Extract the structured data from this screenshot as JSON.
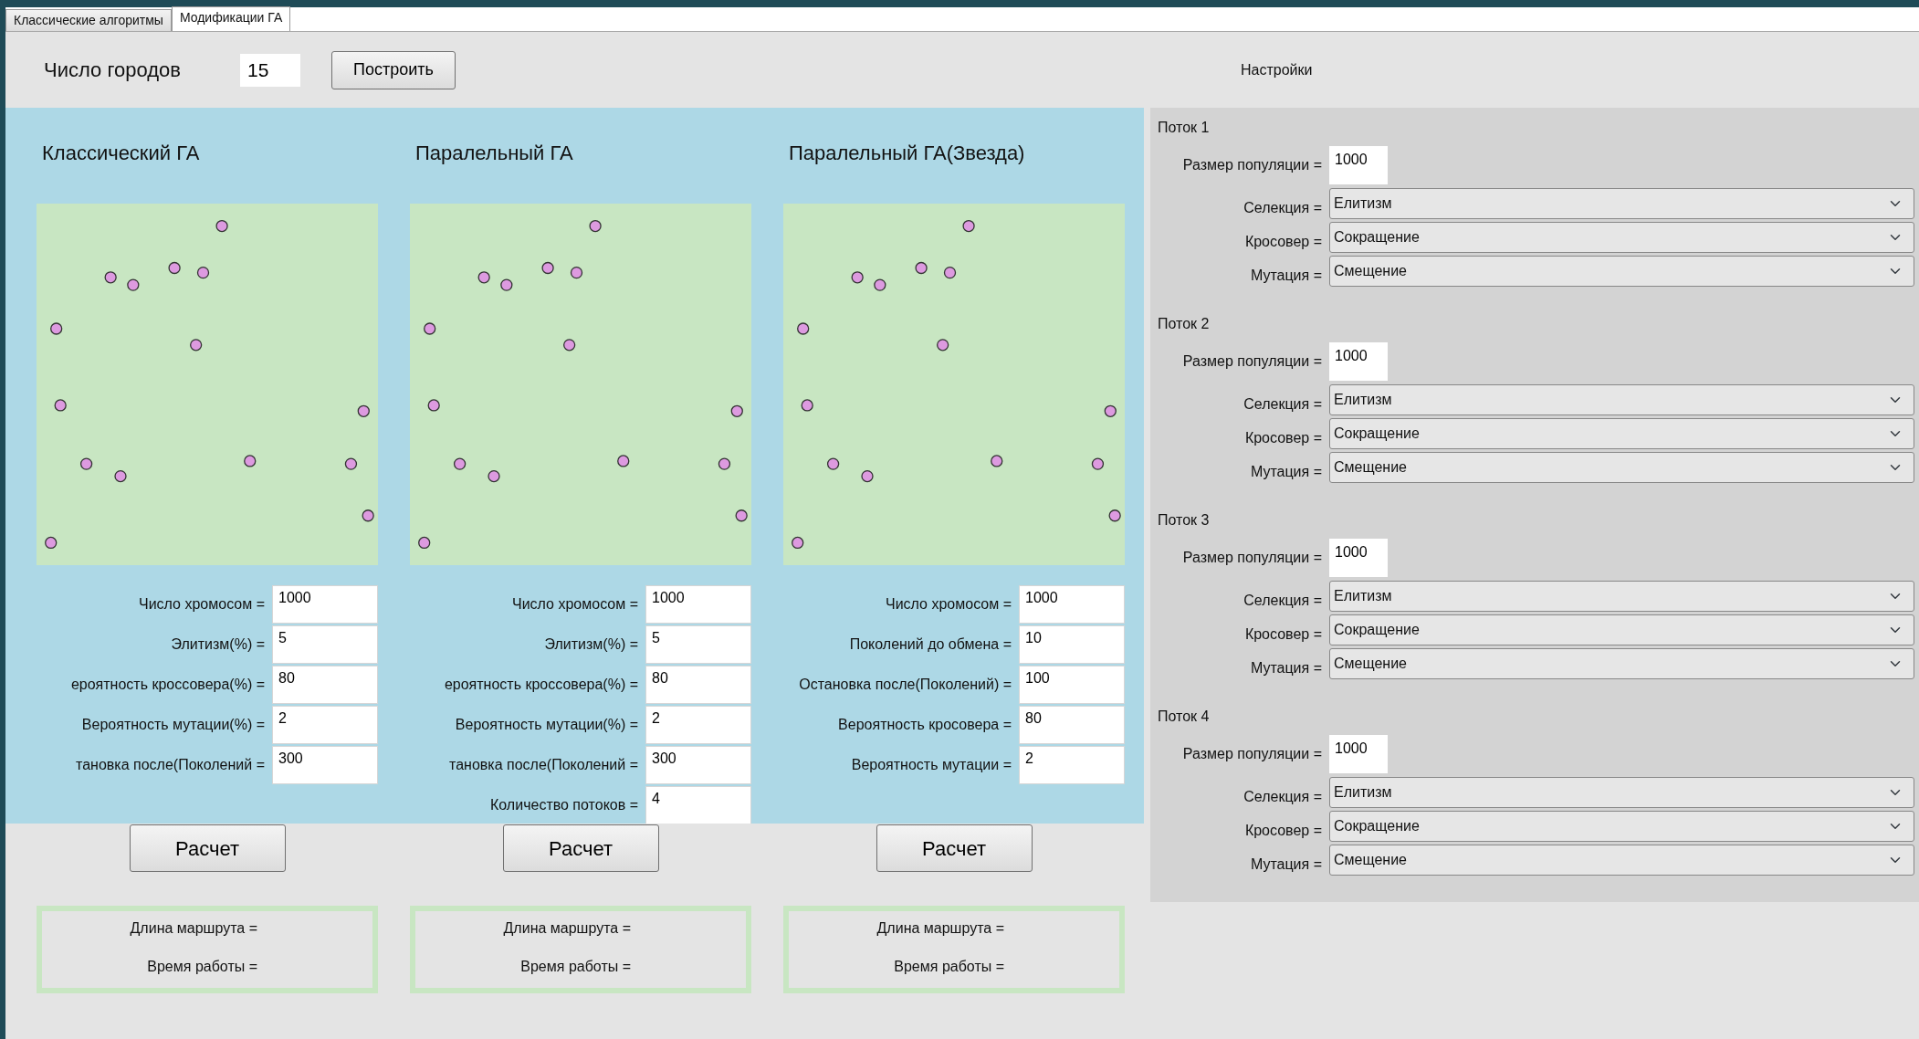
{
  "tabs": [
    {
      "label": "Классические алгоритмы",
      "selected": false
    },
    {
      "label": "Модификации ГА",
      "selected": true
    }
  ],
  "header": {
    "cities_label": "Число городов",
    "cities_value": "15",
    "build_button": "Построить",
    "settings_label": "Настройки"
  },
  "algorithms": [
    {
      "title": "Классический ГА",
      "fields": [
        {
          "label": "Число хромосом =",
          "value": "1000"
        },
        {
          "label": "Элитизм(%) =",
          "value": "5"
        },
        {
          "label": "ероятность кроссовера(%) =",
          "value": "80"
        },
        {
          "label": "Вероятность мутации(%) =",
          "value": "2"
        },
        {
          "label": "тановка после(Поколений =",
          "value": "300"
        }
      ],
      "button": "Расчет",
      "results": [
        "Длина маршрута =",
        "Время работы ="
      ]
    },
    {
      "title": "Паралельный ГА",
      "fields": [
        {
          "label": "Число хромосом =",
          "value": "1000"
        },
        {
          "label": "Элитизм(%) =",
          "value": "5"
        },
        {
          "label": "ероятность кроссовера(%) =",
          "value": "80"
        },
        {
          "label": "Вероятность мутации(%) =",
          "value": "2"
        },
        {
          "label": "тановка после(Поколений =",
          "value": "300"
        },
        {
          "label": "Количество потоков =",
          "value": "4"
        }
      ],
      "button": "Расчет",
      "results": [
        "Длина маршрута =",
        "Время работы ="
      ]
    },
    {
      "title": "Паралельный ГА(Звезда)",
      "fields": [
        {
          "label": "Число хромосом =",
          "value": "1000"
        },
        {
          "label": "Поколений до обмена =",
          "value": "10"
        },
        {
          "label": "Остановка после(Поколений) =",
          "value": "100"
        },
        {
          "label": "Вероятность кросовера =",
          "value": "80"
        },
        {
          "label": "Вероятность мутации =",
          "value": "2"
        }
      ],
      "button": "Расчет",
      "results": [
        "Длина маршрута =",
        "Время работы ="
      ]
    }
  ],
  "streams": [
    {
      "title": "Поток 1",
      "population_label": "Размер популяции =",
      "population_value": "1000",
      "selects": [
        {
          "label": "Селекция =",
          "value": "Елитизм"
        },
        {
          "label": "Кросовер =",
          "value": "Сокращение"
        },
        {
          "label": "Мутация =",
          "value": "Смещение"
        }
      ]
    },
    {
      "title": "Поток 2",
      "population_label": "Размер популяции =",
      "population_value": "1000",
      "selects": [
        {
          "label": "Селекция =",
          "value": "Елитизм"
        },
        {
          "label": "Кросовер =",
          "value": "Сокращение"
        },
        {
          "label": "Мутация =",
          "value": "Смещение"
        }
      ]
    },
    {
      "title": "Поток 3",
      "population_label": "Размер популяции =",
      "population_value": "1000",
      "selects": [
        {
          "label": "Селекция =",
          "value": "Елитизм"
        },
        {
          "label": "Кросовер =",
          "value": "Сокращение"
        },
        {
          "label": "Мутация =",
          "value": "Смещение"
        }
      ]
    },
    {
      "title": "Поток 4",
      "population_label": "Размер популяции =",
      "population_value": "1000",
      "selects": [
        {
          "label": "Селекция =",
          "value": "Елитизм"
        },
        {
          "label": "Кросовер =",
          "value": "Сокращение"
        },
        {
          "label": "Мутация =",
          "value": "Смещение"
        }
      ]
    }
  ]
}
